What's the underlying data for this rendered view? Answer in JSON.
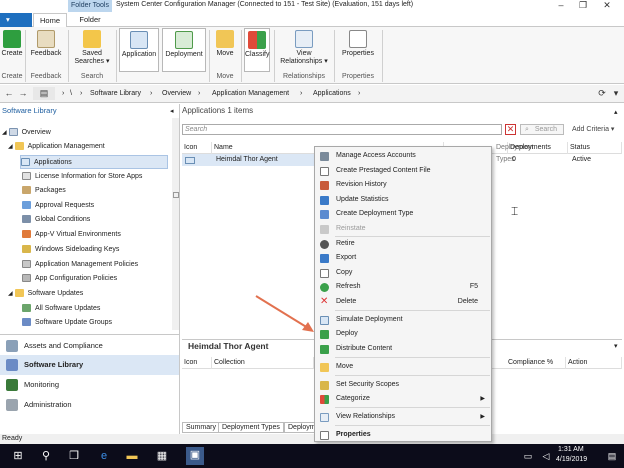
{
  "window": {
    "title": "System Center Configuration Manager (Connected to 151 - Test Site) (Evaluation, 151 days left)",
    "context_tab": "Folder Tools"
  },
  "ribbon": {
    "tabs": [
      "Home",
      "Folder"
    ],
    "buttons": {
      "create": "Create",
      "feedback": "Feedback",
      "saved_searches": "Saved Searches ▾",
      "application": "Application",
      "deployment": "Deployment",
      "move": "Move",
      "classify": "Classify",
      "view_relationships": "View Relationships ▾",
      "properties": "Properties"
    },
    "groups": {
      "create": "Create",
      "feedback": "Feedback",
      "search": "Search",
      "move": "Move",
      "relationships": "Relationships",
      "properties": "Properties"
    }
  },
  "breadcrumb": [
    "\\",
    "Software Library",
    "Overview",
    "Application Management",
    "Applications"
  ],
  "left_pane": {
    "header": "Software Library",
    "tree": [
      {
        "label": "Overview",
        "level": 0
      },
      {
        "label": "Application Management",
        "level": 1
      },
      {
        "label": "Applications",
        "level": 2,
        "selected": true
      },
      {
        "label": "License Information for Store Apps",
        "level": 2
      },
      {
        "label": "Packages",
        "level": 2
      },
      {
        "label": "Approval Requests",
        "level": 2
      },
      {
        "label": "Global Conditions",
        "level": 2
      },
      {
        "label": "App-V Virtual Environments",
        "level": 2
      },
      {
        "label": "Windows Sideloading Keys",
        "level": 2
      },
      {
        "label": "Application Management Policies",
        "level": 2
      },
      {
        "label": "App Configuration Policies",
        "level": 2
      },
      {
        "label": "Software Updates",
        "level": 1
      },
      {
        "label": "All Software Updates",
        "level": 2
      },
      {
        "label": "Software Update Groups",
        "level": 2
      }
    ],
    "workspaces": [
      "Assets and Compliance",
      "Software Library",
      "Monitoring",
      "Administration"
    ]
  },
  "main": {
    "header": "Applications 1 items",
    "search_placeholder": "Search",
    "search_button": "Search",
    "add_criteria": "Add Criteria ▾",
    "columns": [
      "Icon",
      "Name",
      "Deployment Types",
      "Deployments",
      "Status"
    ],
    "rows": [
      {
        "name": "Heimdal Thor Agent",
        "deployments": "0",
        "status": "Active"
      }
    ]
  },
  "details": {
    "title": "Heimdal Thor Agent",
    "columns": [
      "Icon",
      "Collection",
      "Compliance %",
      "Action"
    ],
    "tabs": [
      "Summary",
      "Deployment Types",
      "Deploym"
    ]
  },
  "context_menu": {
    "items": [
      {
        "label": "Manage Access Accounts"
      },
      {
        "label": "Create Prestaged Content File"
      },
      {
        "label": "Revision History"
      },
      {
        "label": "Update Statistics"
      },
      {
        "label": "Create Deployment Type"
      },
      {
        "label": "Reinstate",
        "disabled": true
      },
      {
        "label": "Retire"
      },
      {
        "label": "Export"
      },
      {
        "label": "Copy"
      },
      {
        "label": "Refresh",
        "shortcut": "F5"
      },
      {
        "label": "Delete",
        "shortcut": "Delete"
      },
      {
        "label": "Simulate Deployment"
      },
      {
        "label": "Deploy"
      },
      {
        "label": "Distribute Content"
      },
      {
        "label": "Move"
      },
      {
        "label": "Set Security Scopes"
      },
      {
        "label": "Categorize"
      },
      {
        "label": "View Relationships"
      },
      {
        "label": "Properties"
      }
    ]
  },
  "status_bar": "Ready",
  "taskbar": {
    "time": "1:31 AM",
    "date": "4/19/2019"
  }
}
